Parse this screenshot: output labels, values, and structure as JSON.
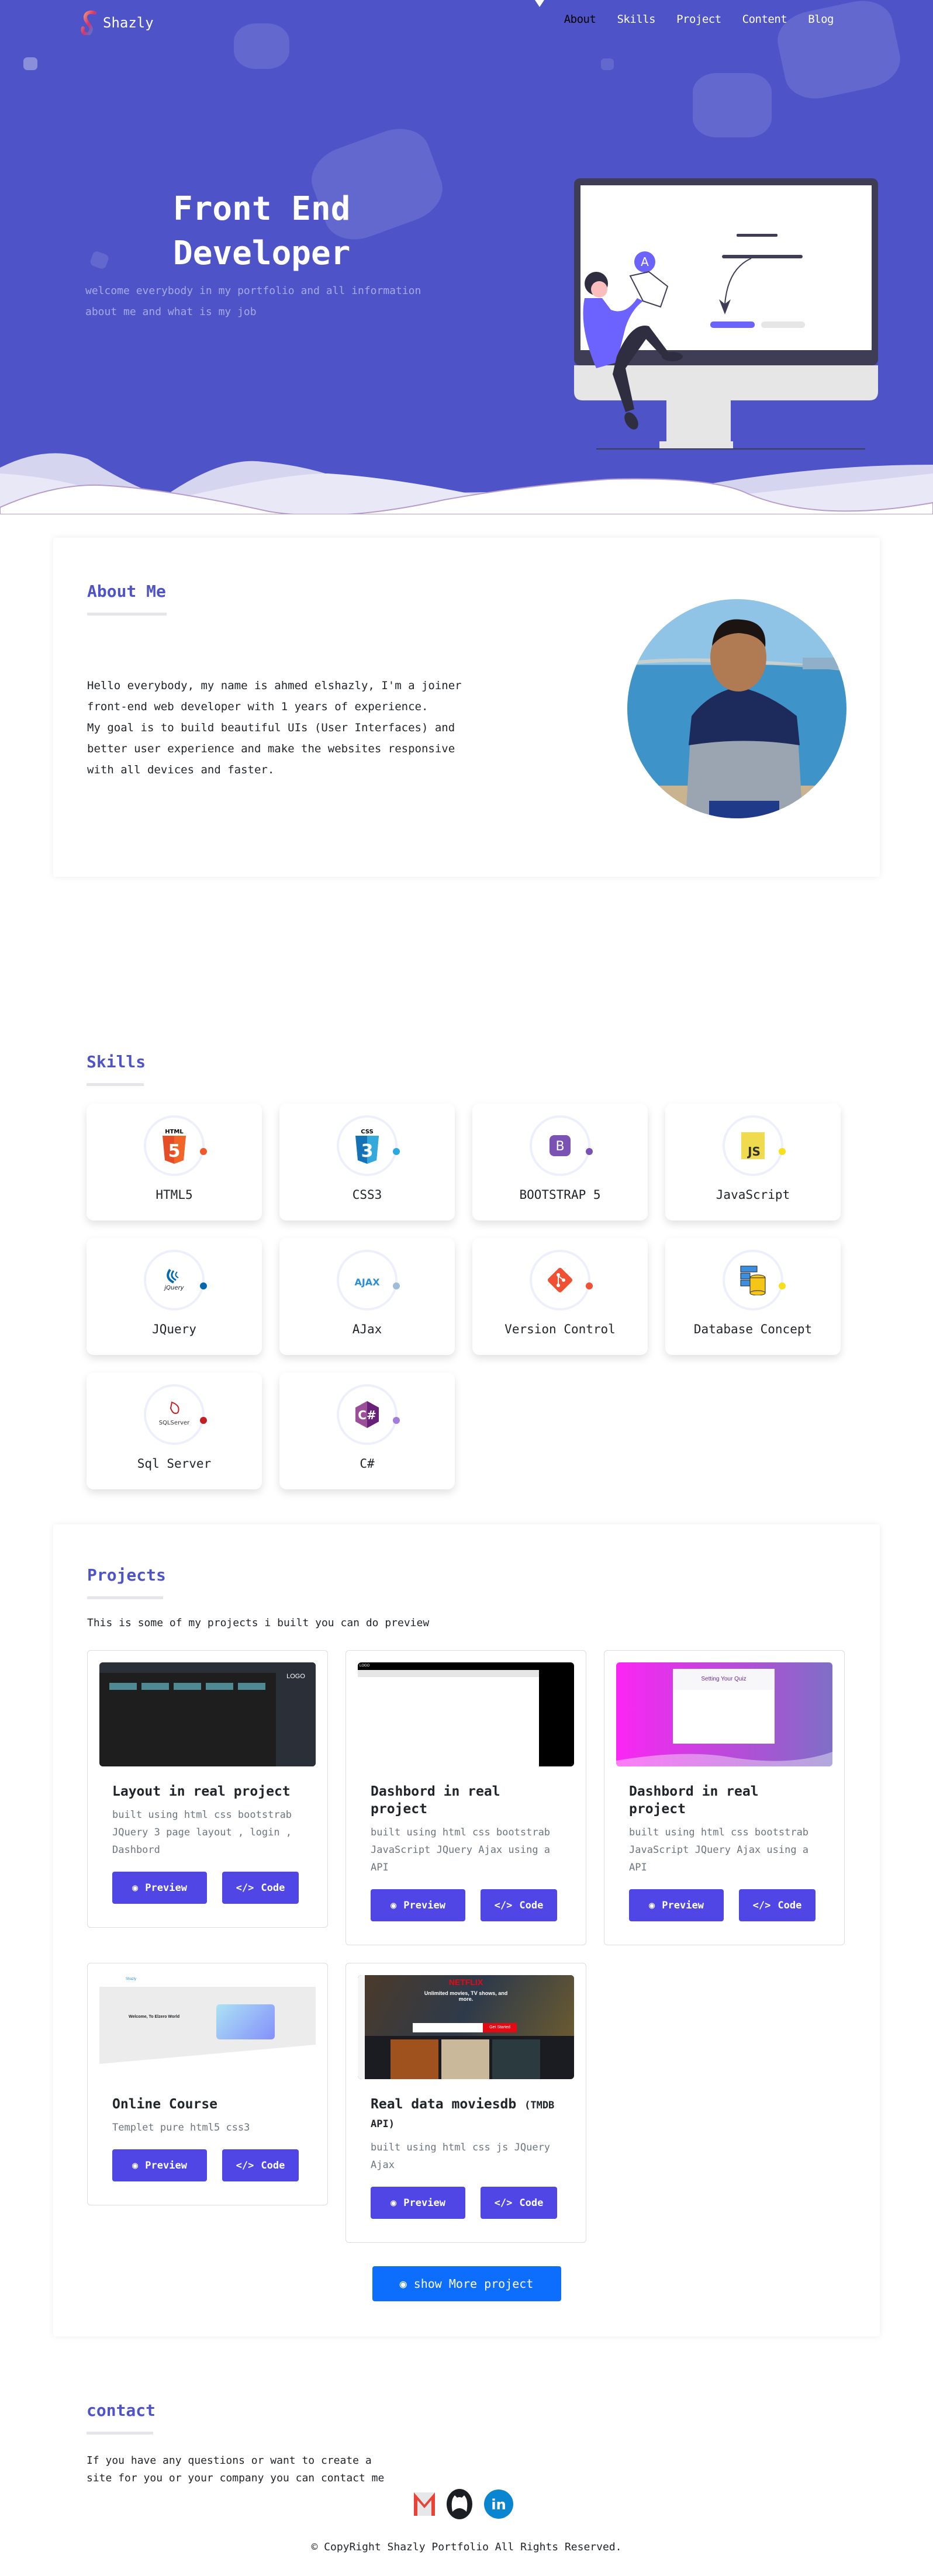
{
  "nav": {
    "brand": "Shazly",
    "items": [
      {
        "label": "About",
        "active": true
      },
      {
        "label": "Skills"
      },
      {
        "label": "Project"
      },
      {
        "label": "Content"
      },
      {
        "label": "Blog"
      }
    ]
  },
  "hero": {
    "title": "Front End Developer",
    "subtitle": "welcome everybody in my portfolio and all information about me and what is my job",
    "illustration_badge": "A"
  },
  "about": {
    "title": "About Me",
    "text_lines": [
      "Hello everybody, my name is ahmed elshazly, I'm a joiner",
      "front-end web developer with 1 years of experience.",
      "My goal is to build beautiful UIs (User Interfaces) and",
      "better user experience and make the websites responsive",
      "with all devices and faster."
    ]
  },
  "skills": {
    "title": "Skills",
    "items": [
      {
        "label": "HTML5",
        "icon": "html5-logo",
        "dot": "#f0582a"
      },
      {
        "label": "CSS3",
        "icon": "css3-logo",
        "dot": "#29a9e1"
      },
      {
        "label": "BOOTSTRAP 5",
        "icon": "bootstrap-logo",
        "dot": "#7952b3"
      },
      {
        "label": "JavaScript",
        "icon": "javascript-logo",
        "dot": "#f7df1e"
      },
      {
        "label": "JQuery",
        "icon": "jquery-logo",
        "dot": "#0769ad"
      },
      {
        "label": "AJax",
        "icon": "ajax-logo",
        "dot": "#a0bcd6"
      },
      {
        "label": "Version Control",
        "icon": "git-logo",
        "dot": "#f05033"
      },
      {
        "label": "Database Concept",
        "icon": "database-logo",
        "dot": "#f7df1e"
      },
      {
        "label": "Sql Server",
        "icon": "sqlserver-logo",
        "dot": "#c41e22"
      },
      {
        "label": "C#",
        "icon": "csharp-logo",
        "dot": "#a27ddb"
      }
    ],
    "icon_text": {
      "html": "HTML",
      "css": "CSS",
      "bootstrap": "B",
      "js": "JS",
      "jquery": "jQuery",
      "ajax": "AJAX",
      "sql": "SQLServer",
      "csharp": "C#"
    }
  },
  "projects": {
    "title": "Projects",
    "subtitle": "This is some of my projects i built you can do preview",
    "preview_label": "Preview",
    "code_label": "Code",
    "items": [
      {
        "title": "Layout in real project",
        "title_small": "",
        "desc": "built using html css bootstrab JQuery 3 page layout , login , Dashbord",
        "shot": "dark-dashboard",
        "shot_logo": "LOGO"
      },
      {
        "title": "Dashbord in real project",
        "title_small": "",
        "desc": "built using html css bootstrab JavaScript JQuery Ajax using a API",
        "shot": "light-dashboard",
        "shot_logo": "LOGO"
      },
      {
        "title": "Dashbord in real project",
        "title_small": "",
        "desc": "built using html css bootstrab JavaScript JQuery Ajax using a API",
        "shot": "quiz",
        "shot_heading": "Setting Your Quiz"
      },
      {
        "title": "Online Course",
        "title_small": "",
        "desc": "Templet pure html5 css3",
        "shot": "course",
        "shot_brand": "Shazly",
        "shot_heading": "Welcome, To Elzero World"
      },
      {
        "title": "Real data moviesdb",
        "title_small": "(TMDB API)",
        "desc": "built using html css js JQuery Ajax",
        "shot": "netflix",
        "shot_brand": "NETFLIX",
        "shot_heading": "Unlimited movies, TV shows, and more.",
        "shot_cta": "Get Started"
      }
    ],
    "more_label": "show More project"
  },
  "contact": {
    "title": "contact",
    "text_lines": [
      "If you have any questions or want to create a",
      "site for you or your company you can contact me"
    ],
    "social": [
      "gmail",
      "github",
      "linkedin"
    ]
  },
  "footer": {
    "copyright": "© CopyRight Shazly Portfolio All Rights Reserved."
  }
}
